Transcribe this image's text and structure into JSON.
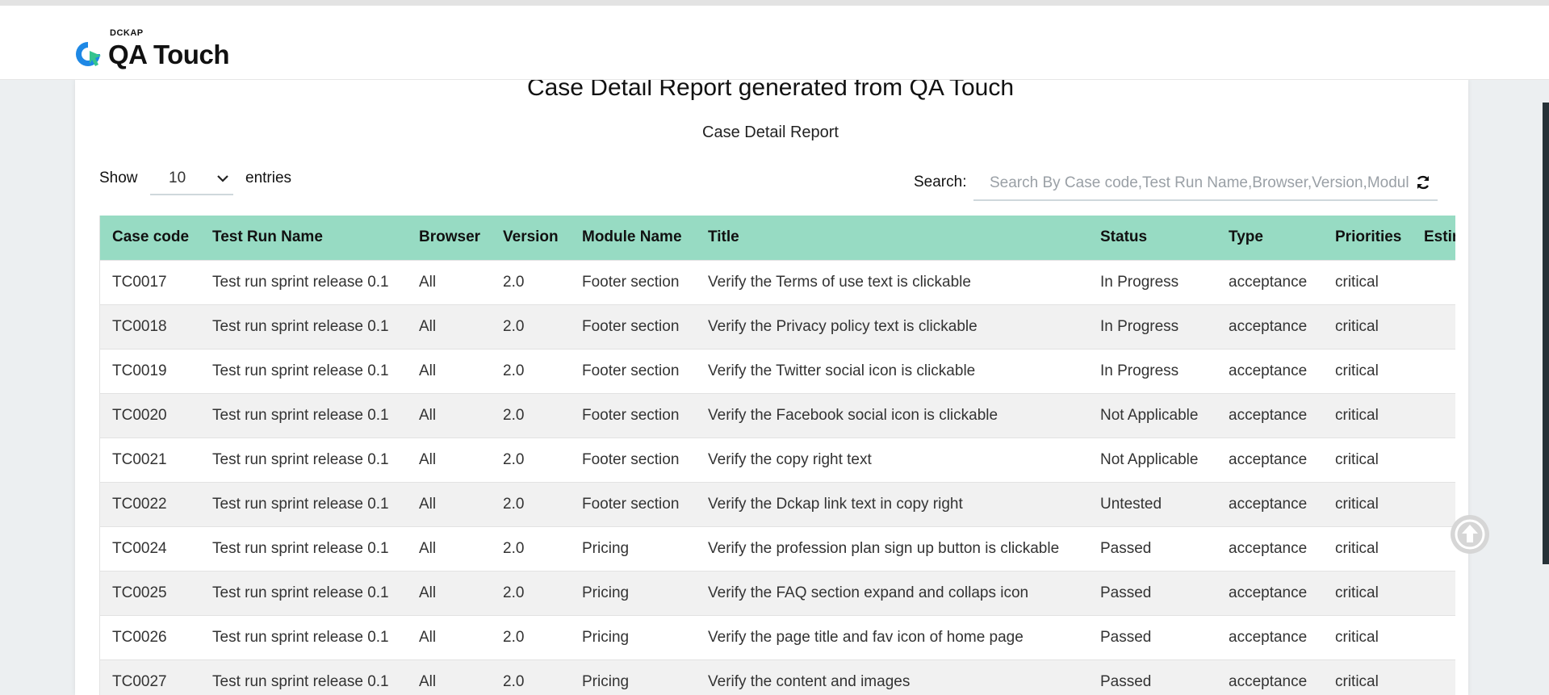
{
  "header": {
    "logo_small": "DCKAP",
    "logo_main": "QA Touch",
    "brand_colors": {
      "blue": "#1e88e5",
      "green": "#34c38f"
    }
  },
  "report": {
    "title": "Case Detail Report generated from QA Touch",
    "subtitle": "Case Detail Report"
  },
  "controls": {
    "show_label": "Show",
    "page_length": "10",
    "entries_label": "entries",
    "search_label": "Search:",
    "search_placeholder": "Search By Case code,Test Run Name,Browser,Version,Module"
  },
  "table": {
    "columns": [
      "Case code",
      "Test Run Name",
      "Browser",
      "Version",
      "Module Name",
      "Title",
      "Status",
      "Type",
      "Priorities",
      "Estima"
    ],
    "rows": [
      [
        "TC0017",
        "Test run sprint release 0.1",
        "All",
        "2.0",
        "Footer section",
        "Verify the Terms of use text is clickable",
        "In Progress",
        "acceptance",
        "critical",
        ""
      ],
      [
        "TC0018",
        "Test run sprint release 0.1",
        "All",
        "2.0",
        "Footer section",
        "Verify the Privacy policy text is clickable",
        "In Progress",
        "acceptance",
        "critical",
        ""
      ],
      [
        "TC0019",
        "Test run sprint release 0.1",
        "All",
        "2.0",
        "Footer section",
        "Verify the Twitter social icon is clickable",
        "In Progress",
        "acceptance",
        "critical",
        ""
      ],
      [
        "TC0020",
        "Test run sprint release 0.1",
        "All",
        "2.0",
        "Footer section",
        "Verify the Facebook social icon is clickable",
        "Not Applicable",
        "acceptance",
        "critical",
        ""
      ],
      [
        "TC0021",
        "Test run sprint release 0.1",
        "All",
        "2.0",
        "Footer section",
        "Verify the copy right text",
        "Not Applicable",
        "acceptance",
        "critical",
        ""
      ],
      [
        "TC0022",
        "Test run sprint release 0.1",
        "All",
        "2.0",
        "Footer section",
        "Verify the Dckap link text in copy right",
        "Untested",
        "acceptance",
        "critical",
        ""
      ],
      [
        "TC0024",
        "Test run sprint release 0.1",
        "All",
        "2.0",
        "Pricing",
        "Verify the profession plan sign up button is clickable",
        "Passed",
        "acceptance",
        "critical",
        ""
      ],
      [
        "TC0025",
        "Test run sprint release 0.1",
        "All",
        "2.0",
        "Pricing",
        "Verify the FAQ section expand and collaps icon",
        "Passed",
        "acceptance",
        "critical",
        ""
      ],
      [
        "TC0026",
        "Test run sprint release 0.1",
        "All",
        "2.0",
        "Pricing",
        "Verify the page title and fav icon of home page",
        "Passed",
        "acceptance",
        "critical",
        ""
      ],
      [
        "TC0027",
        "Test run sprint release 0.1",
        "All",
        "2.0",
        "Pricing",
        "Verify the content and images",
        "Passed",
        "acceptance",
        "critical",
        ""
      ]
    ]
  },
  "icons": {
    "logo": "qa-touch-logo-icon",
    "dropdown": "chevron-down-icon",
    "refresh": "refresh-icon",
    "scroll_top": "arrow-up-circle-icon"
  },
  "colors": {
    "table_header_bg": "#97dbc3",
    "row_alt_bg": "#f1f1f1",
    "page_bg": "#eceff1",
    "scroll_top_bg": "#d6d6d6"
  }
}
